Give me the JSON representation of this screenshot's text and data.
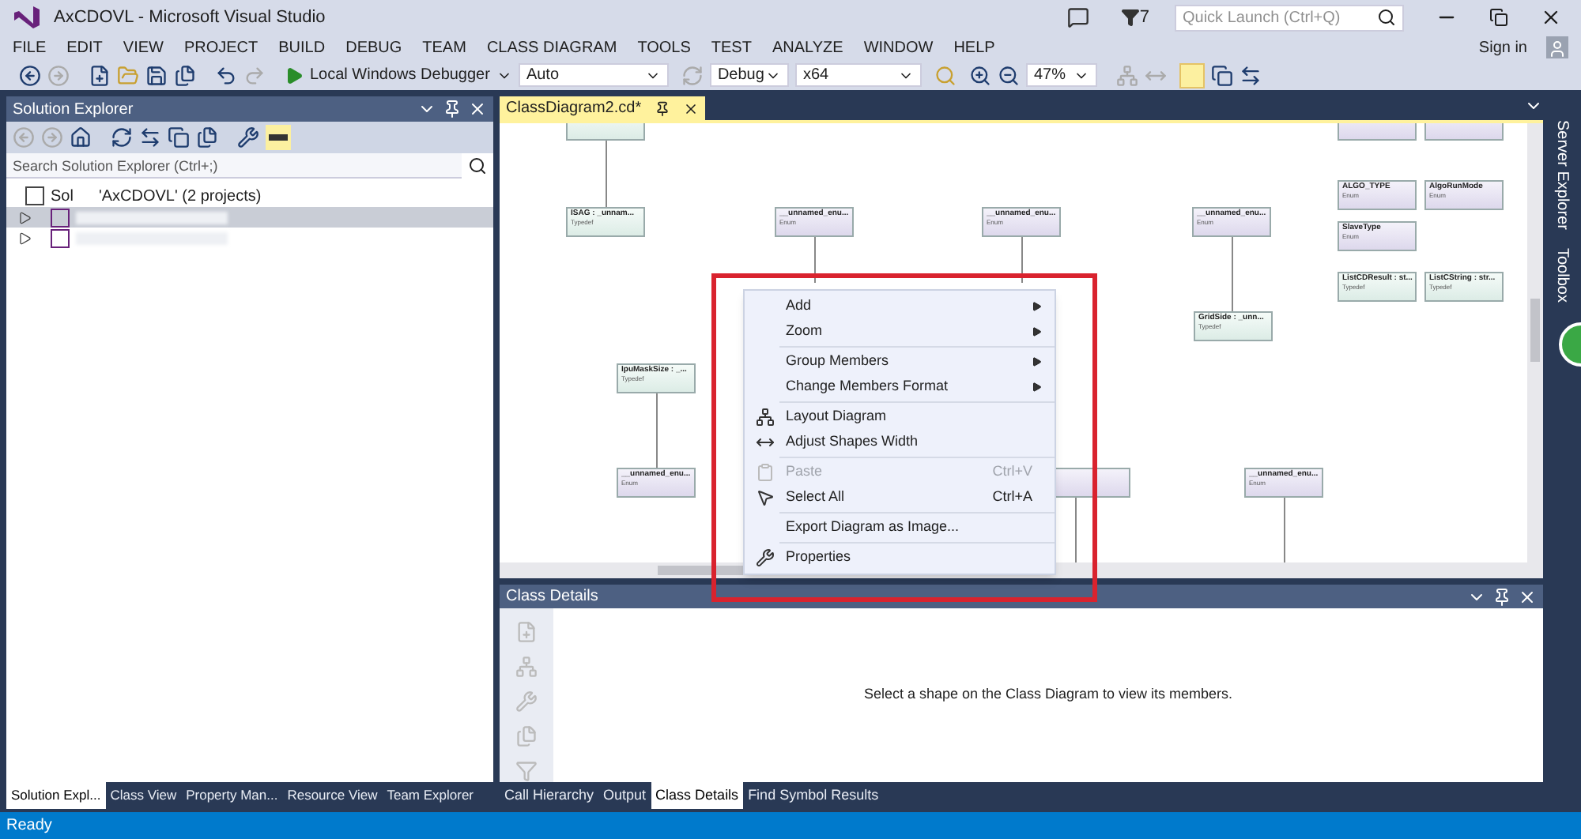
{
  "window": {
    "title": "AxCDOVL - Microsoft Visual Studio",
    "notification_count": "7",
    "quick_launch": {
      "placeholder": "Quick Launch (Ctrl+Q)"
    },
    "sign_in": "Sign in"
  },
  "menu": [
    "FILE",
    "EDIT",
    "VIEW",
    "PROJECT",
    "BUILD",
    "DEBUG",
    "TEAM",
    "CLASS DIAGRAM",
    "TOOLS",
    "TEST",
    "ANALYZE",
    "WINDOW",
    "HELP"
  ],
  "toolbar": {
    "run_button": "Local Windows Debugger",
    "dropdowns": [
      {
        "value": "Auto"
      },
      {
        "value": "Debug"
      },
      {
        "value": "x64"
      },
      {
        "value": "47%"
      }
    ]
  },
  "solution_explorer": {
    "title": "Solution Explorer",
    "search": {
      "placeholder": "Search Solution Explorer (Ctrl+;)"
    },
    "tree": [
      {
        "label_start": "Sol",
        "label_end": "'AxCDOVL' (2 projects)",
        "children": [
          {
            "selected": true
          },
          {
            "selected": false
          }
        ]
      }
    ]
  },
  "document_tab": {
    "title": "ClassDiagram2.cd*",
    "selected": true
  },
  "side_tabs": [
    "Server Explorer",
    "Toolbox"
  ],
  "diagram": {
    "shapes": [
      {
        "kind": "typedef"
      },
      {
        "kind": "typedef",
        "name": "ISAG : _unnam...",
        "type": "Typedef"
      },
      {
        "kind": "enum",
        "name": "__unnamed_enu...",
        "type": "Enum"
      },
      {
        "kind": "enum",
        "name": "__unnamed_enu...",
        "type": "Enum"
      },
      {
        "kind": "enum",
        "name": "__unnamed_enu...",
        "type": "Enum"
      },
      {
        "kind": "typedef",
        "name": "GridSide : _unn...",
        "type": "Typedef"
      },
      {
        "kind": "typedef",
        "name": "IpuMaskSize : _...",
        "type": "Typedef"
      },
      {
        "kind": "enum",
        "name": "__unnamed_enu...",
        "type": "Enum"
      },
      {
        "kind": "enum"
      },
      {
        "kind": "enum",
        "name": "__unnamed_enu...",
        "type": "Enum"
      },
      {
        "kind": "enum"
      },
      {
        "kind": "enum"
      },
      {
        "kind": "enum",
        "name": "ALGO_TYPE",
        "type": "Enum"
      },
      {
        "kind": "enum",
        "name": "AlgoRunMode",
        "type": "Enum"
      },
      {
        "kind": "enum",
        "name": "SlaveType",
        "type": "Enum"
      },
      {
        "kind": "typedef",
        "name": "ListCDResult : st...",
        "type": "Typedef"
      },
      {
        "kind": "typedef",
        "name": "ListCString : str...",
        "type": "Typedef"
      }
    ]
  },
  "context_menu": [
    {
      "kind": "item",
      "label": "Add",
      "submenu": true,
      "disabled": false
    },
    {
      "kind": "item",
      "label": "Zoom",
      "submenu": true,
      "disabled": false
    },
    {
      "kind": "separator"
    },
    {
      "kind": "item",
      "label": "Group Members",
      "submenu": true,
      "disabled": false
    },
    {
      "kind": "item",
      "label": "Change Members Format",
      "submenu": true,
      "disabled": false
    },
    {
      "kind": "separator"
    },
    {
      "kind": "item",
      "label": "Layout Diagram",
      "submenu": false,
      "disabled": false
    },
    {
      "kind": "item",
      "label": "Adjust Shapes Width",
      "submenu": false,
      "disabled": false
    },
    {
      "kind": "separator"
    },
    {
      "kind": "item",
      "label": "Paste",
      "shortcut": "Ctrl+V",
      "submenu": false,
      "disabled": true
    },
    {
      "kind": "item",
      "label": "Select All",
      "shortcut": "Ctrl+A",
      "submenu": false,
      "disabled": false
    },
    {
      "kind": "separator"
    },
    {
      "kind": "item",
      "label": "Export Diagram as Image...",
      "submenu": false,
      "disabled": false
    },
    {
      "kind": "separator"
    },
    {
      "kind": "item",
      "label": "Properties",
      "submenu": false,
      "disabled": false
    }
  ],
  "class_details": {
    "title": "Class Details",
    "message": "Select a shape on the Class Diagram to view its members."
  },
  "left_tabs": [
    {
      "label": "Solution Expl...",
      "selected": true
    },
    {
      "label": "Class View",
      "selected": false
    },
    {
      "label": "Property Man...",
      "selected": false
    },
    {
      "label": "Resource View",
      "selected": false
    },
    {
      "label": "Team Explorer",
      "selected": false
    }
  ],
  "bottom_tabs": [
    {
      "label": "Call Hierarchy",
      "selected": false
    },
    {
      "label": "Output",
      "selected": false
    },
    {
      "label": "Class Details",
      "selected": true
    },
    {
      "label": "Find Symbol Results",
      "selected": false
    }
  ],
  "status_bar": {
    "text": "Ready"
  }
}
